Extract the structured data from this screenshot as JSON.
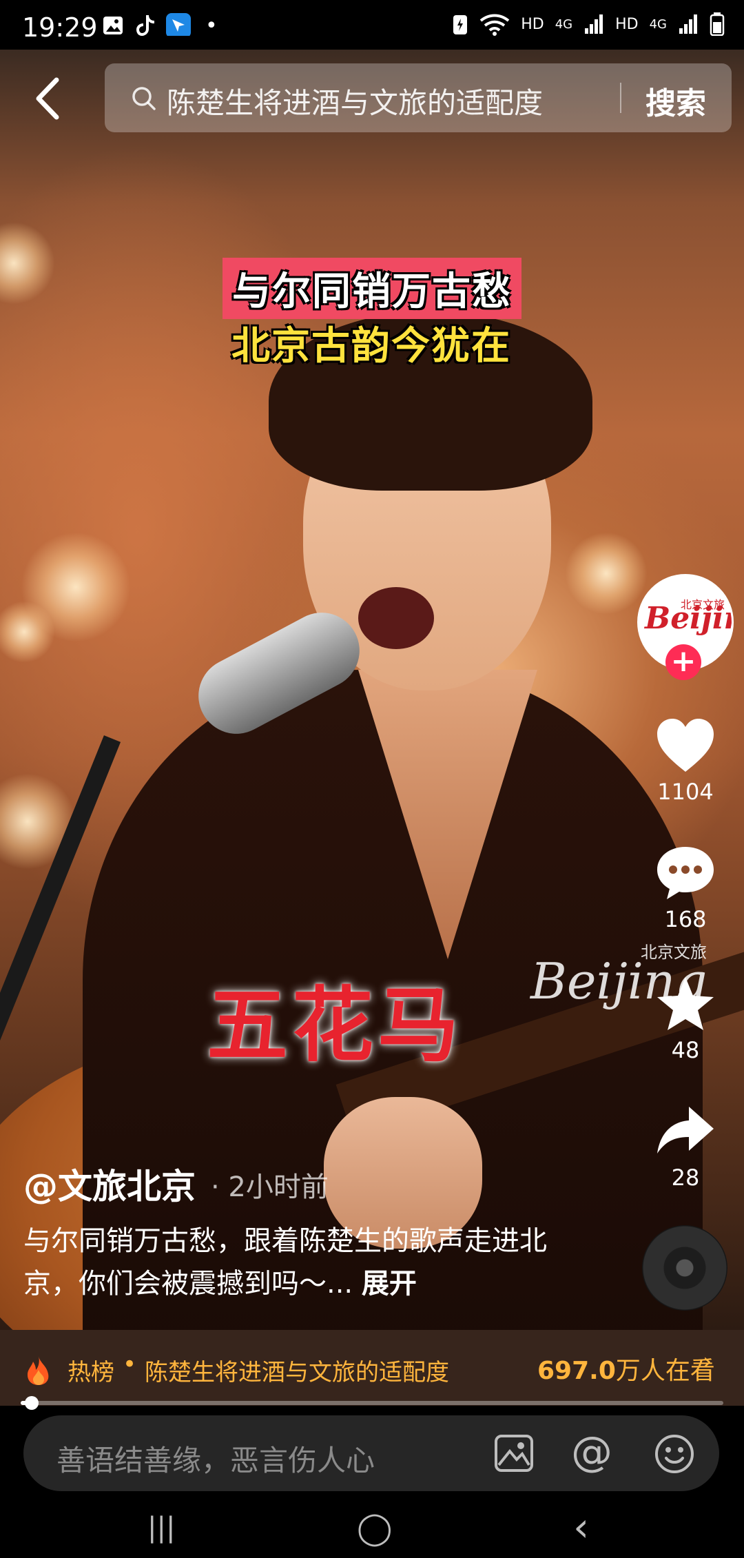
{
  "status_bar": {
    "time": "19:29",
    "dot": "•",
    "hd1": "HD",
    "net1": "4G",
    "hd2": "HD",
    "net2": "4G"
  },
  "search": {
    "query": "陈楚生将进酒与文旅的适配度",
    "button_label": "搜索"
  },
  "video": {
    "caption_line1": "与尔同销万古愁",
    "caption_line2": "北京古韵今犹在",
    "song_title": "五花马",
    "watermark": "Beijing",
    "watermark_sub": "北京文旅"
  },
  "author_panel": {
    "avatar_text": "Beijing",
    "avatar_sub": "北京文旅",
    "follow_symbol": "+"
  },
  "actions": {
    "likes": "1104",
    "comments": "168",
    "favorites": "48",
    "shares": "28"
  },
  "post": {
    "author": "@文旅北京",
    "time": "· 2小时前",
    "description": "与尔同销万古愁，跟着陈楚生的歌声走进北京，你们会被震撼到吗～...",
    "expand_label": "展开"
  },
  "hot_list": {
    "label": "热榜",
    "separator": "•",
    "topic": "陈楚生将进酒与文旅的适配度",
    "viewers_number": "697.0",
    "viewers_suffix": "万人在看",
    "arrow": "›"
  },
  "playback": {
    "progress_fraction": 0.01
  },
  "comment_bar": {
    "placeholder": "善语结善缘，恶言伤人心",
    "at_symbol": "@"
  },
  "nav": {
    "recents": "|||",
    "home": "◯",
    "back": "‹"
  },
  "colors": {
    "accent": "#fe2c55",
    "hot": "#ffb53d",
    "caption_bg": "#f04a62",
    "caption_yellow": "#ffe23d"
  }
}
